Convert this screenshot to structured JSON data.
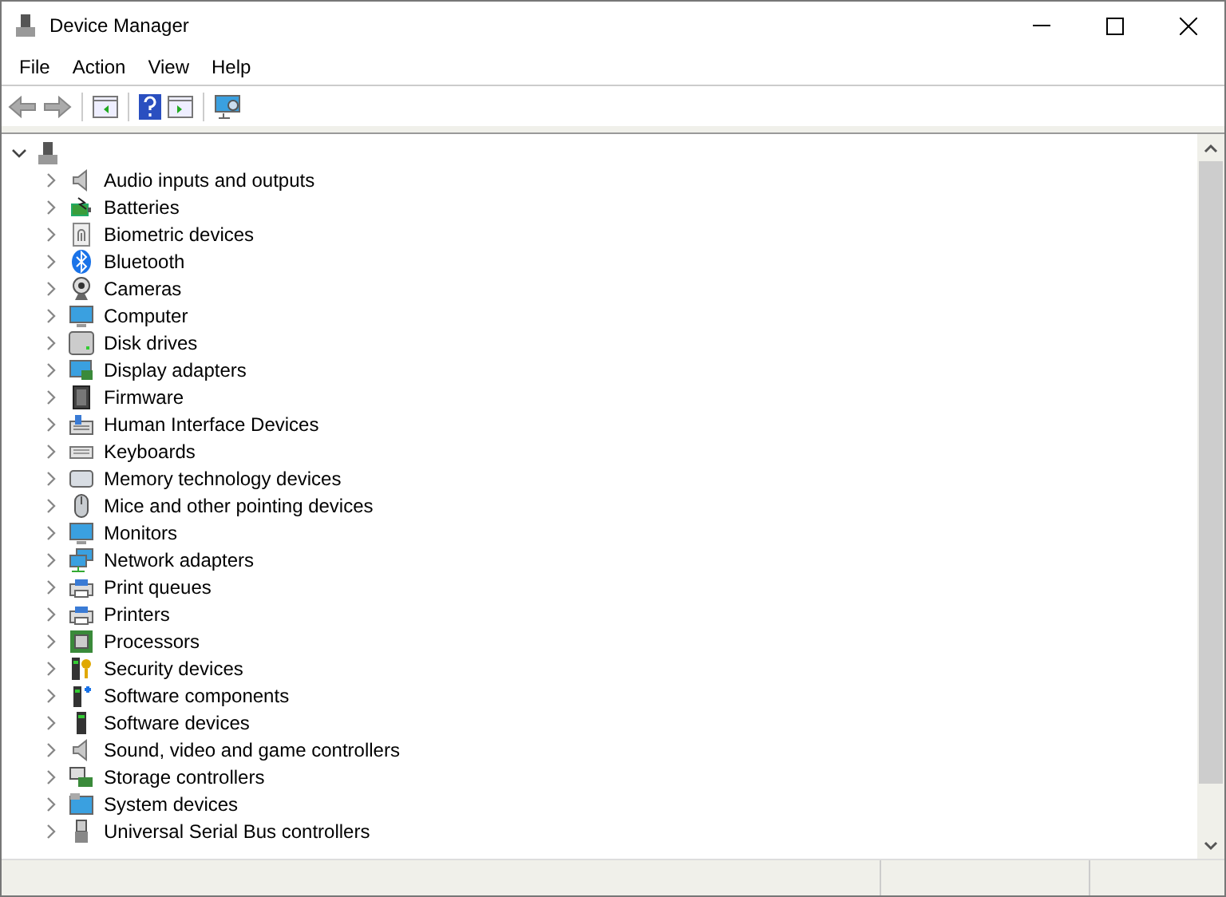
{
  "window": {
    "title": "Device Manager"
  },
  "menu": [
    "File",
    "Action",
    "View",
    "Help"
  ],
  "tree": {
    "expanded": true,
    "children": [
      {
        "label": "Audio inputs and outputs",
        "kind": "speaker",
        "expanded": false
      },
      {
        "label": "Batteries",
        "kind": "battery",
        "expanded": false
      },
      {
        "label": "Biometric devices",
        "kind": "fingerprint",
        "expanded": false
      },
      {
        "label": "Bluetooth",
        "kind": "bluetooth",
        "expanded": false
      },
      {
        "label": "Cameras",
        "kind": "webcam",
        "expanded": false
      },
      {
        "label": "Computer",
        "kind": "monitor",
        "expanded": false
      },
      {
        "label": "Disk drives",
        "kind": "drive",
        "expanded": false
      },
      {
        "label": "Display adapters",
        "kind": "displaycard",
        "expanded": false
      },
      {
        "label": "Firmware",
        "kind": "chip",
        "expanded": false
      },
      {
        "label": "Human Interface Devices",
        "kind": "hid",
        "expanded": false
      },
      {
        "label": "Keyboards",
        "kind": "keyboard",
        "expanded": false
      },
      {
        "label": "Memory technology devices",
        "kind": "card",
        "expanded": false
      },
      {
        "label": "Mice and other pointing devices",
        "kind": "mouse",
        "expanded": false
      },
      {
        "label": "Monitors",
        "kind": "monitor",
        "expanded": false
      },
      {
        "label": "Network adapters",
        "kind": "network",
        "expanded": false
      },
      {
        "label": "Print queues",
        "kind": "printer",
        "expanded": false
      },
      {
        "label": "Printers",
        "kind": "printer",
        "expanded": false
      },
      {
        "label": "Processors",
        "kind": "processor",
        "expanded": false
      },
      {
        "label": "Security devices",
        "kind": "security",
        "expanded": false
      },
      {
        "label": "Software components",
        "kind": "softcomp",
        "expanded": false
      },
      {
        "label": "Software devices",
        "kind": "tower",
        "expanded": false
      },
      {
        "label": "Sound, video and game controllers",
        "kind": "speaker",
        "expanded": false
      },
      {
        "label": "Storage controllers",
        "kind": "storage",
        "expanded": false
      },
      {
        "label": "System devices",
        "kind": "folder",
        "expanded": false
      },
      {
        "label": "Universal Serial Bus controllers",
        "kind": "usb",
        "expanded": false
      }
    ]
  }
}
